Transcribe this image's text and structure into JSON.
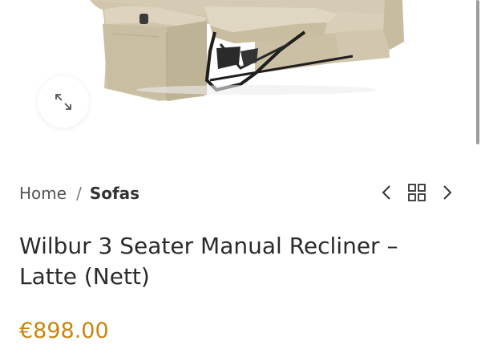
{
  "breadcrumb": {
    "home": "Home",
    "separator": "/",
    "current": "Sofas"
  },
  "product": {
    "title": "Wilbur 3 Seater Manual Recliner – Latte (Nett)",
    "price": "€898.00",
    "image_subject": "beige fabric recliner sofa with footrest extended"
  },
  "icons": {
    "zoom": "expand-icon",
    "prev": "chevron-left-icon",
    "grid": "grid-icon",
    "next": "chevron-right-icon"
  },
  "colors": {
    "price": "#c8860f",
    "fabric": "#cfc3a8",
    "text": "#2b2b2b"
  }
}
